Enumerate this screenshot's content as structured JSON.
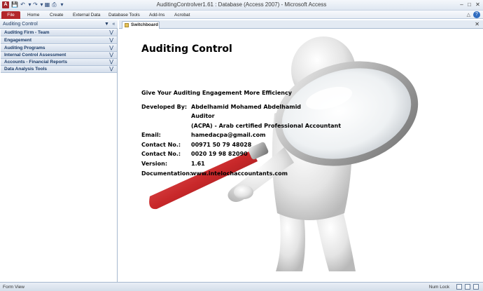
{
  "window": {
    "title": "AuditingControlver1.61 : Database (Access 2007)  -  Microsoft Access",
    "app_icon": "A"
  },
  "ribbon": {
    "tabs": [
      "File",
      "Home",
      "Create",
      "External Data",
      "Database Tools",
      "Add-Ins",
      "Acrobat"
    ]
  },
  "nav": {
    "title": "Auditing Control",
    "groups": [
      "Auditing Firm - Team",
      "Engagement",
      "Auditing Programs",
      "Internal Control Assessment",
      "Accounts - Financial Reports",
      "Data Analysis Tools"
    ]
  },
  "document": {
    "tab_label": "Switchboard"
  },
  "switchboard": {
    "title": "Auditing Control",
    "tagline": "Give Your Auditing Engagement More Efficiency",
    "developed_by_label": "Developed By:",
    "developer_name": "Abdelhamid Mohamed Abdelhamid",
    "developer_role": "Auditor",
    "developer_cert": "(ACPA) - Arab certified Professional Accountant",
    "email_label": "Email:",
    "email_value": "hamedacpa@gmail.com",
    "contact1_label": "Contact No.:",
    "contact1_value": "00971 50 79 48028",
    "contact2_label": "Contact No.:",
    "contact2_value": "0020 19 98 82090",
    "version_label": "Version:",
    "version_value": "1.61",
    "documentation_label": "Documentation:",
    "documentation_value": "www.intelochaccountants.com"
  },
  "status": {
    "left": "Form View",
    "right": "Num Lock"
  },
  "colors": {
    "file_tab": "#b3262b",
    "nav_text": "#1b3a66",
    "magnifier_handle": "#c8282a"
  }
}
